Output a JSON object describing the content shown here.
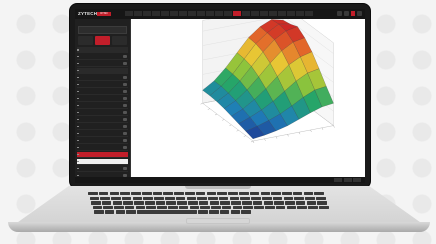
{
  "app": {
    "brand": "ZYTECH",
    "brand_tag": "DYNO",
    "menu_tabs": [
      "",
      "",
      "",
      "",
      "",
      "",
      "",
      "",
      "",
      "",
      "",
      "",
      "",
      "",
      "",
      "",
      "",
      "",
      "",
      "",
      ""
    ],
    "menu_active_index": 12,
    "top_buttons": [
      ""
    ]
  },
  "sidebar": {
    "title": "",
    "subtitle": "",
    "search_placeholder": "",
    "actions": [
      {
        "label": ""
      },
      {
        "label": ""
      },
      {
        "label": ""
      }
    ],
    "items": [
      {
        "label": "",
        "kind": "section"
      },
      {
        "label": "",
        "kind": "item"
      },
      {
        "label": "",
        "kind": "item"
      },
      {
        "label": "",
        "kind": "section"
      },
      {
        "label": "",
        "kind": "item"
      },
      {
        "label": "",
        "kind": "item"
      },
      {
        "label": "",
        "kind": "item"
      },
      {
        "label": "",
        "kind": "item"
      },
      {
        "label": "",
        "kind": "item"
      },
      {
        "label": "",
        "kind": "item"
      },
      {
        "label": "",
        "kind": "item"
      },
      {
        "label": "",
        "kind": "item"
      },
      {
        "label": "",
        "kind": "item"
      },
      {
        "label": "",
        "kind": "item"
      },
      {
        "label": "",
        "kind": "item"
      },
      {
        "label": "",
        "kind": "selected"
      },
      {
        "label": "",
        "kind": "light"
      },
      {
        "label": "",
        "kind": "item"
      },
      {
        "label": "",
        "kind": "item"
      },
      {
        "label": "",
        "kind": "item"
      },
      {
        "label": "",
        "kind": "item"
      },
      {
        "label": "",
        "kind": "item"
      },
      {
        "label": "",
        "kind": "item"
      },
      {
        "label": "",
        "kind": "item"
      },
      {
        "label": "",
        "kind": "item"
      }
    ]
  },
  "main": {
    "view": "3d-surface-map",
    "colormap": [
      "#1e2a8a",
      "#1f7fb8",
      "#22a46b",
      "#8fc43b",
      "#e8c934",
      "#e36a2a",
      "#c91f25"
    ],
    "surface_grid": [
      [
        0.03,
        0.05,
        0.08,
        0.12,
        0.18,
        0.24,
        0.29,
        0.31
      ],
      [
        0.06,
        0.1,
        0.15,
        0.21,
        0.29,
        0.38,
        0.45,
        0.47
      ],
      [
        0.09,
        0.15,
        0.22,
        0.31,
        0.42,
        0.53,
        0.61,
        0.64
      ],
      [
        0.12,
        0.19,
        0.29,
        0.41,
        0.55,
        0.68,
        0.76,
        0.8
      ],
      [
        0.15,
        0.23,
        0.35,
        0.5,
        0.66,
        0.8,
        0.89,
        0.92
      ],
      [
        0.17,
        0.26,
        0.4,
        0.57,
        0.74,
        0.88,
        0.97,
        1.0
      ],
      [
        0.18,
        0.28,
        0.42,
        0.6,
        0.78,
        0.9,
        0.99,
        0.96
      ],
      [
        0.18,
        0.28,
        0.43,
        0.61,
        0.79,
        0.91,
        0.98,
        0.94
      ]
    ]
  },
  "statusbar": {
    "text": ""
  }
}
